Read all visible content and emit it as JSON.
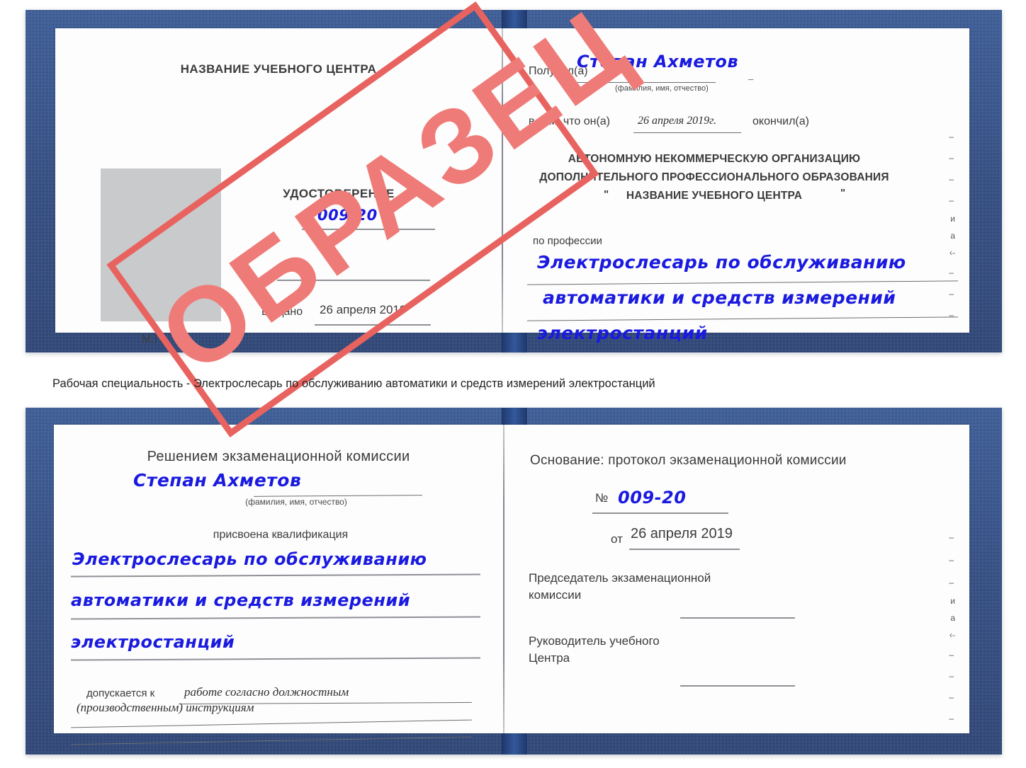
{
  "watermark": {
    "text": "ОБРАЗЕЦ",
    "color": "#ef7b78",
    "border_color": "#e8635f"
  },
  "caption": "Рабочая специальность - Электрослесарь по обслуживанию автоматики и средств измерений электростанций",
  "colors": {
    "cover_blue": "#25437f",
    "handwriting_blue": "#1a1ae0",
    "rule_gray": "#8e9196",
    "photo_gray": "#c9cacc"
  },
  "certificate_top": {
    "page_left": {
      "center_title": "НАЗВАНИЕ УЧЕБНОГО ЦЕНТРА",
      "doc_type": "УДОСТОВЕРЕНИЕ",
      "number_label": "№",
      "number_value": "009-20",
      "issued_label": "Выдано",
      "issued_value": "26 апреля 2019",
      "seal_label": "М.П."
    },
    "page_right": {
      "received_label": "Получил(а)",
      "received_value": "Степан Ахметов",
      "fio_hint": "(фамилия, имя, отчество)",
      "in_that_label": "в том, что он(а)",
      "finish_date": "26 апреля 2019г.",
      "finished_label": "окончил(а)",
      "org_line1": "АВТОНОМНУЮ НЕКОММЕРЧЕСКУЮ ОРГАНИЗАЦИЮ",
      "org_line2": "ДОПОЛНИТЕЛЬНОГО ПРОФЕССИОНАЛЬНОГО ОБРАЗОВАНИЯ",
      "org_quote_open": "\"",
      "org_line3": "НАЗВАНИЕ УЧЕБНОГО ЦЕНТРА",
      "org_quote_close": "\"",
      "profession_label": "по профессии",
      "profession_line1": "Электрослесарь по обслуживанию",
      "profession_line2": "автоматики и средств измерений",
      "profession_line3": "электростанций",
      "edge_scraps": [
        "–",
        "–",
        "–",
        "–",
        "и",
        "а",
        "‹-",
        "–",
        "–",
        "–"
      ]
    }
  },
  "certificate_bottom": {
    "page_left": {
      "commission_title": "Решением экзаменационной комиссии",
      "name_value": "Степан Ахметов",
      "fio_hint": "(фамилия, имя, отчество)",
      "qualification_label": "присвоена квалификация",
      "qualification_line1": "Электрослесарь по обслуживанию",
      "qualification_line2": "автоматики и средств измерений",
      "qualification_line3": "электростанций",
      "allowed_label": "допускается к",
      "allowed_value1": "работе согласно должностным",
      "allowed_value2": "(производственным) инструкциям"
    },
    "page_right": {
      "basis_label": "Основание: протокол экзаменационной комиссии",
      "number_label": "№",
      "number_value": "009-20",
      "date_label": "от",
      "date_value": "26 апреля 2019",
      "chairman_line1": "Председатель экзаменационной",
      "chairman_line2": "комиссии",
      "head_line1": "Руководитель учебного",
      "head_line2": "Центра",
      "edge_scraps": [
        "–",
        "–",
        "–",
        "и",
        "а",
        "‹-",
        "–",
        "–",
        "–",
        "–"
      ]
    }
  }
}
